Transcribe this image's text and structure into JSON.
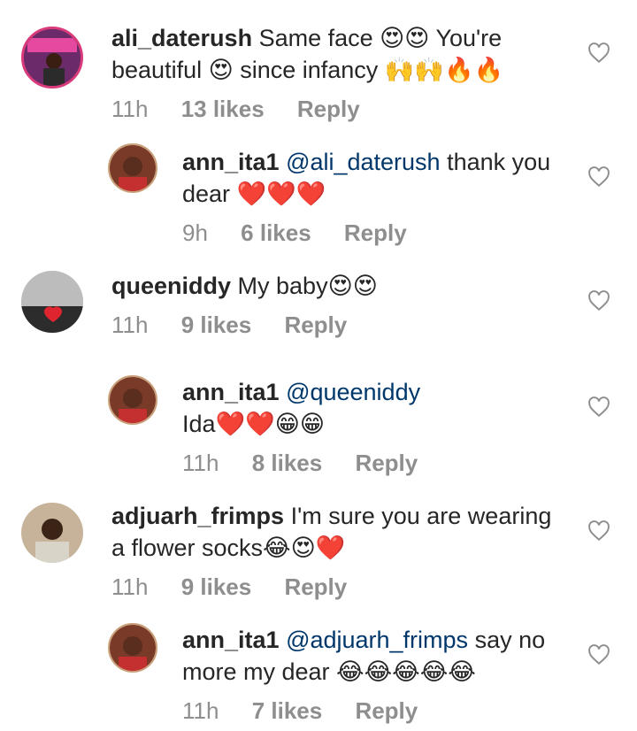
{
  "comments": [
    {
      "user": "ali_daterush",
      "text": "Same face 😍😍 You're",
      "text2": "beautiful 😍 since infancy 🙌🙌🔥🔥",
      "time": "11h",
      "likes": "13 likes",
      "reply": "Reply"
    },
    {
      "user": "ann_ita1",
      "mention": "@ali_daterush",
      "text": "thank you",
      "text2": "dear ❤️❤️❤️",
      "time": "9h",
      "likes": "6 likes",
      "reply": "Reply"
    },
    {
      "user": "queeniddy",
      "text": "My baby😍😍",
      "time": "11h",
      "likes": "9 likes",
      "reply": "Reply"
    },
    {
      "user": "ann_ita1",
      "mention": "@queeniddy",
      "text2": "Ida❤️❤️😁😁",
      "time": "11h",
      "likes": "8 likes",
      "reply": "Reply"
    },
    {
      "user": "adjuarh_frimps",
      "text": "I'm sure you are wearing",
      "text2": "a flower socks😂😍❤️",
      "time": "11h",
      "likes": "9 likes",
      "reply": "Reply"
    },
    {
      "user": "ann_ita1",
      "mention": "@adjuarh_frimps",
      "text": "say no",
      "text2": "more my dear 😂😂😂😂😂",
      "time": "11h",
      "likes": "7 likes",
      "reply": "Reply"
    }
  ],
  "icons": {
    "like": "heart-outline-icon"
  },
  "colors": {
    "mention": "#00376b",
    "meta": "#8e8e8e",
    "heart": "#e0245e"
  }
}
